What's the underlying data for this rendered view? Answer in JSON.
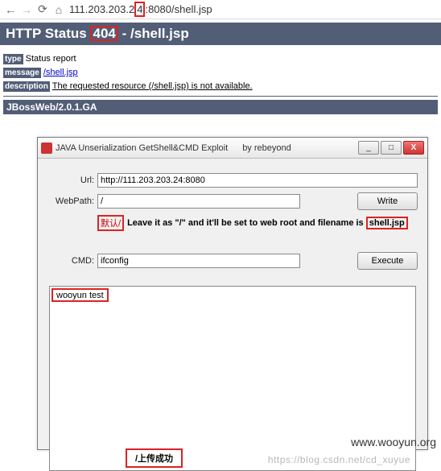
{
  "browser": {
    "url_full": "111.203.203.24:8080/shell.jsp",
    "url_left": "111.203.203.2",
    "url_hl": "4",
    "url_right": ":8080/shell.jsp"
  },
  "status": {
    "prefix": "HTTP Status ",
    "code": "404",
    "suffix": " - /shell.jsp"
  },
  "page": {
    "type_label": "type",
    "type_value": "Status report",
    "message_label": "message",
    "message_value": "/shell.jsp",
    "description_label": "description",
    "description_value": "The requested resource (/shell.jsp) is not available.",
    "server": "JBossWeb/2.0.1.GA"
  },
  "dialog": {
    "title": "JAVA Unserialization GetShell&CMD Exploit",
    "author": "by rebeyond",
    "min": "_",
    "max": "□",
    "close": "X",
    "url_label": "Url:",
    "url_value": "http://111.203.203.24:8080",
    "webpath_label": "WebPath:",
    "webpath_value": "/",
    "write_btn": "Write",
    "hint_default": "默认/",
    "hint_text_a": "Leave it as \"/\" and it'll be set to web root and filename is ",
    "hint_text_b": "shell.jsp",
    "cmd_label": "CMD:",
    "cmd_value": "ifconfig",
    "execute_btn": "Execute",
    "output_line": "wooyun test",
    "upload_ok": "/上传成功",
    "blog_wm": "https://blog.csdn.net/cd_xuyue"
  },
  "watermark": "www.wooyun.org"
}
